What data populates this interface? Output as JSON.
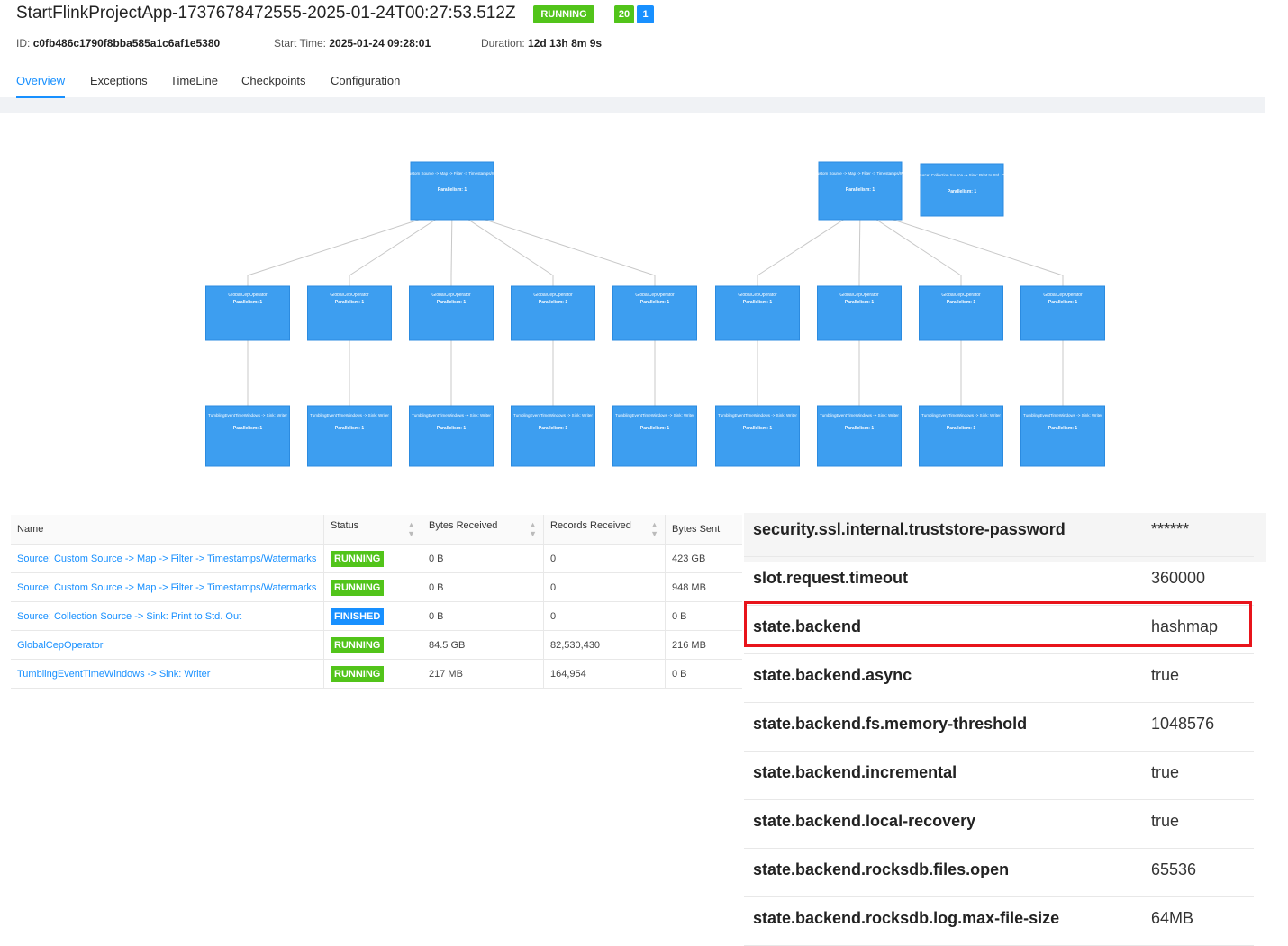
{
  "header": {
    "job_name": "StartFlinkProjectApp-1737678472555-2025-01-24T00:27:53.512Z",
    "status": "RUNNING",
    "tasks_running": "20",
    "tasks_finished": "1",
    "id_label": "ID:",
    "id_value": "c0fb486c1790f8bba585a1c6af1e5380",
    "start_label": "Start Time:",
    "start_value": "2025-01-24 09:28:01",
    "duration_label": "Duration:",
    "duration_value": "12d 13h 8m 9s"
  },
  "tabs": [
    {
      "label": "Overview",
      "active": true
    },
    {
      "label": "Exceptions",
      "active": false
    },
    {
      "label": "TimeLine",
      "active": false
    },
    {
      "label": "Checkpoints",
      "active": false
    },
    {
      "label": "Configuration",
      "active": false
    }
  ],
  "colors": {
    "accent": "#1890ff",
    "running": "#52c41a",
    "finished": "#1890ff",
    "node": "#3d9ef0",
    "highlight": "#e8141b"
  },
  "graph": {
    "source_nodes": [
      {
        "title": "Source: Custom Source -> Map -> Filter -> Timestamps/Watermarks",
        "parallelism": "Parallelism: 1"
      },
      {
        "title": "Source: Custom Source -> Map -> Filter -> Timestamps/Watermarks",
        "parallelism": "Parallelism: 1"
      },
      {
        "title": "Source: Collection Source -> Sink: Print to Std. Out",
        "parallelism": "Parallelism: 1"
      }
    ],
    "operator_title": "GlobalCepOperator",
    "operator_parallelism": "Parallelism: 1",
    "window_title": "TumblingEventTimeWindows -> Sink: Writer",
    "window_parallelism": "Parallelism: 1",
    "columns": 9
  },
  "vertices": {
    "headers": [
      "Name",
      "Status",
      "Bytes Received",
      "Records Received",
      "Bytes Sent"
    ],
    "rows": [
      {
        "name": "Source: Custom Source -> Map -> Filter -> Timestamps/Watermarks",
        "status": "RUNNING",
        "bytes_received": "0 B",
        "records_received": "0",
        "bytes_sent": "423 GB"
      },
      {
        "name": "Source: Custom Source -> Map -> Filter -> Timestamps/Watermarks",
        "status": "RUNNING",
        "bytes_received": "0 B",
        "records_received": "0",
        "bytes_sent": "948 MB"
      },
      {
        "name": "Source: Collection Source -> Sink: Print to Std. Out",
        "status": "FINISHED",
        "bytes_received": "0 B",
        "records_received": "0",
        "bytes_sent": "0 B"
      },
      {
        "name": "GlobalCepOperator",
        "status": "RUNNING",
        "bytes_received": "84.5 GB",
        "records_received": "82,530,430",
        "bytes_sent": "216 MB"
      },
      {
        "name": "TumblingEventTimeWindows -> Sink: Writer",
        "status": "RUNNING",
        "bytes_received": "217 MB",
        "records_received": "164,954",
        "bytes_sent": "0 B"
      }
    ]
  },
  "config": [
    {
      "key": "security.ssl.internal.truststore-password",
      "value": "******"
    },
    {
      "key": "slot.request.timeout",
      "value": "360000"
    },
    {
      "key": "state.backend",
      "value": "hashmap",
      "highlighted": true
    },
    {
      "key": "state.backend.async",
      "value": "true"
    },
    {
      "key": "state.backend.fs.memory-threshold",
      "value": "1048576"
    },
    {
      "key": "state.backend.incremental",
      "value": "true"
    },
    {
      "key": "state.backend.local-recovery",
      "value": "true"
    },
    {
      "key": "state.backend.rocksdb.files.open",
      "value": "65536"
    },
    {
      "key": "state.backend.rocksdb.log.max-file-size",
      "value": "64MB"
    }
  ]
}
